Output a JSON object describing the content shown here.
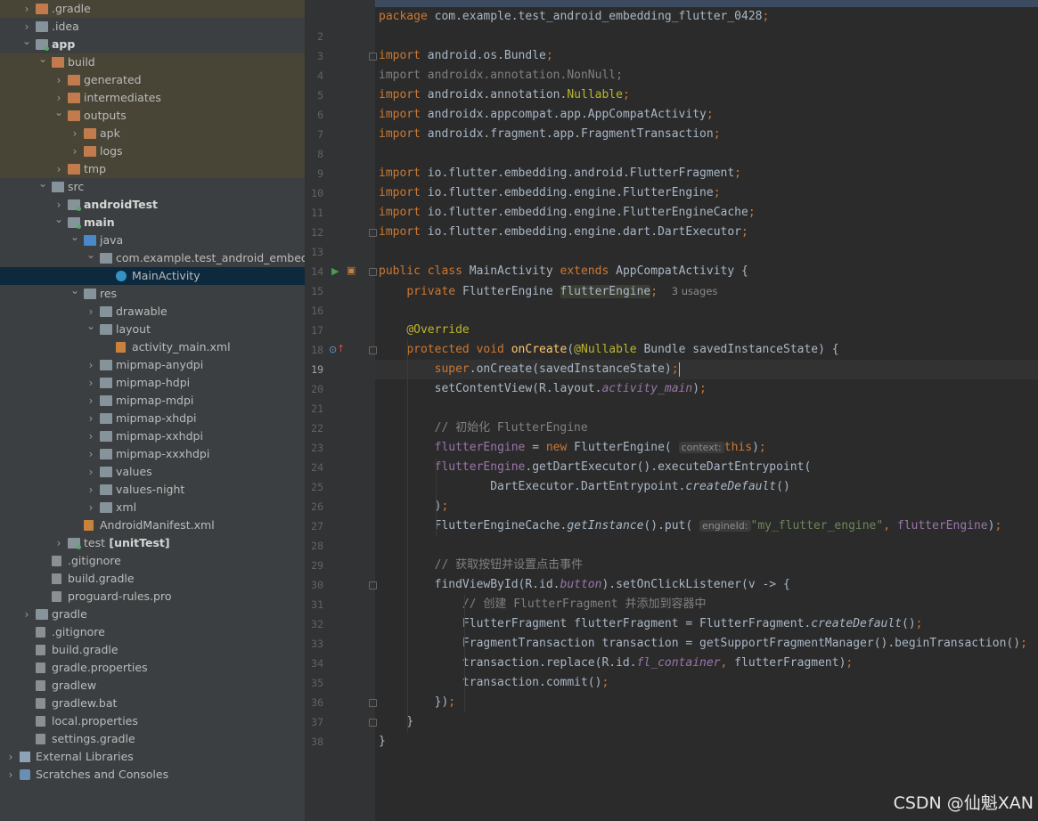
{
  "project_tree": [
    {
      "label": ".gradle",
      "depth": 2,
      "icon": "folder-orange",
      "arrow": "right",
      "hl": true
    },
    {
      "label": ".idea",
      "depth": 2,
      "icon": "folder-gray",
      "arrow": "right"
    },
    {
      "label": "app",
      "depth": 2,
      "icon": "module-folder",
      "arrow": "down",
      "bold": true
    },
    {
      "label": "build",
      "depth": 3,
      "icon": "folder-orange",
      "arrow": "down",
      "hl": true
    },
    {
      "label": "generated",
      "depth": 4,
      "icon": "folder-orange",
      "arrow": "right",
      "hl": true
    },
    {
      "label": "intermediates",
      "depth": 4,
      "icon": "folder-orange",
      "arrow": "right",
      "hl": true
    },
    {
      "label": "outputs",
      "depth": 4,
      "icon": "folder-orange",
      "arrow": "down",
      "hl": true
    },
    {
      "label": "apk",
      "depth": 5,
      "icon": "folder-orange",
      "arrow": "right",
      "hl": true
    },
    {
      "label": "logs",
      "depth": 5,
      "icon": "folder-orange",
      "arrow": "right",
      "hl": true
    },
    {
      "label": "tmp",
      "depth": 4,
      "icon": "folder-orange",
      "arrow": "right",
      "hl": true
    },
    {
      "label": "src",
      "depth": 3,
      "icon": "folder-gray",
      "arrow": "down"
    },
    {
      "label": "androidTest",
      "depth": 4,
      "icon": "module-folder",
      "arrow": "right",
      "bold": true
    },
    {
      "label": "main",
      "depth": 4,
      "icon": "module-folder",
      "arrow": "down",
      "bold": true
    },
    {
      "label": "java",
      "depth": 5,
      "icon": "folder-blue",
      "arrow": "down"
    },
    {
      "label": "com.example.test_android_embeddi",
      "depth": 6,
      "icon": "package-folder",
      "arrow": "down"
    },
    {
      "label": "MainActivity",
      "depth": 7,
      "icon": "class-icon",
      "arrow": "",
      "sel": true
    },
    {
      "label": "res",
      "depth": 5,
      "icon": "res-folder",
      "arrow": "down"
    },
    {
      "label": "drawable",
      "depth": 6,
      "icon": "folder-gray",
      "arrow": "right"
    },
    {
      "label": "layout",
      "depth": 6,
      "icon": "folder-gray",
      "arrow": "down"
    },
    {
      "label": "activity_main.xml",
      "depth": 7,
      "icon": "xml-file",
      "arrow": ""
    },
    {
      "label": "mipmap-anydpi",
      "depth": 6,
      "icon": "folder-gray",
      "arrow": "right"
    },
    {
      "label": "mipmap-hdpi",
      "depth": 6,
      "icon": "folder-gray",
      "arrow": "right"
    },
    {
      "label": "mipmap-mdpi",
      "depth": 6,
      "icon": "folder-gray",
      "arrow": "right"
    },
    {
      "label": "mipmap-xhdpi",
      "depth": 6,
      "icon": "folder-gray",
      "arrow": "right"
    },
    {
      "label": "mipmap-xxhdpi",
      "depth": 6,
      "icon": "folder-gray",
      "arrow": "right"
    },
    {
      "label": "mipmap-xxxhdpi",
      "depth": 6,
      "icon": "folder-gray",
      "arrow": "right"
    },
    {
      "label": "values",
      "depth": 6,
      "icon": "folder-gray",
      "arrow": "right"
    },
    {
      "label": "values-night",
      "depth": 6,
      "icon": "folder-gray",
      "arrow": "right"
    },
    {
      "label": "xml",
      "depth": 6,
      "icon": "folder-gray",
      "arrow": "right"
    },
    {
      "label": "AndroidManifest.xml",
      "depth": 5,
      "icon": "manifest-file",
      "arrow": ""
    },
    {
      "label": "test",
      "suffix": "[unitTest]",
      "depth": 4,
      "icon": "module-folder",
      "arrow": "right"
    },
    {
      "label": ".gitignore",
      "depth": 3,
      "icon": "gitignore-file",
      "arrow": ""
    },
    {
      "label": "build.gradle",
      "depth": 3,
      "icon": "gradle-file",
      "arrow": ""
    },
    {
      "label": "proguard-rules.pro",
      "depth": 3,
      "icon": "text-file",
      "arrow": ""
    },
    {
      "label": "gradle",
      "depth": 2,
      "icon": "folder-gray",
      "arrow": "right"
    },
    {
      "label": ".gitignore",
      "depth": 2,
      "icon": "gitignore-file",
      "arrow": ""
    },
    {
      "label": "build.gradle",
      "depth": 2,
      "icon": "gradle-file",
      "arrow": ""
    },
    {
      "label": "gradle.properties",
      "depth": 2,
      "icon": "properties-file",
      "arrow": ""
    },
    {
      "label": "gradlew",
      "depth": 2,
      "icon": "script-file",
      "arrow": ""
    },
    {
      "label": "gradlew.bat",
      "depth": 2,
      "icon": "text-file",
      "arrow": ""
    },
    {
      "label": "local.properties",
      "depth": 2,
      "icon": "properties-file",
      "arrow": ""
    },
    {
      "label": "settings.gradle",
      "depth": 2,
      "icon": "gradle-file",
      "arrow": ""
    },
    {
      "label": "External Libraries",
      "depth": 1,
      "icon": "library-icon",
      "arrow": "right"
    },
    {
      "label": "Scratches and Consoles",
      "depth": 1,
      "icon": "scratch-icon",
      "arrow": "right"
    }
  ],
  "editor": {
    "current_line": 19,
    "lines": [
      {
        "n": "",
        "segs": [
          [
            "kw",
            "package "
          ],
          [
            "",
            "com.example.test_android_embedding_flutter_0428"
          ],
          [
            "kw",
            ";"
          ]
        ]
      },
      {
        "n": "2",
        "segs": []
      },
      {
        "n": "3",
        "segs": [
          [
            "kw",
            "import "
          ],
          [
            "",
            "android.os.Bundle"
          ],
          [
            "kw",
            ";"
          ]
        ]
      },
      {
        "n": "4",
        "segs": [
          [
            "unused",
            "import androidx.annotation.NonNull;"
          ]
        ]
      },
      {
        "n": "5",
        "segs": [
          [
            "kw",
            "import "
          ],
          [
            "",
            "androidx.annotation."
          ],
          [
            "an",
            "Nullable"
          ],
          [
            "kw",
            ";"
          ]
        ]
      },
      {
        "n": "6",
        "segs": [
          [
            "kw",
            "import "
          ],
          [
            "",
            "androidx.appcompat.app.AppCompatActivity"
          ],
          [
            "kw",
            ";"
          ]
        ]
      },
      {
        "n": "7",
        "segs": [
          [
            "kw",
            "import "
          ],
          [
            "",
            "androidx.fragment.app.FragmentTransaction"
          ],
          [
            "kw",
            ";"
          ]
        ]
      },
      {
        "n": "8",
        "segs": []
      },
      {
        "n": "9",
        "segs": [
          [
            "kw",
            "import "
          ],
          [
            "",
            "io.flutter.embedding.android.FlutterFragment"
          ],
          [
            "kw",
            ";"
          ]
        ]
      },
      {
        "n": "10",
        "segs": [
          [
            "kw",
            "import "
          ],
          [
            "",
            "io.flutter.embedding.engine.FlutterEngine"
          ],
          [
            "kw",
            ";"
          ]
        ]
      },
      {
        "n": "11",
        "segs": [
          [
            "kw",
            "import "
          ],
          [
            "",
            "io.flutter.embedding.engine.FlutterEngineCache"
          ],
          [
            "kw",
            ";"
          ]
        ]
      },
      {
        "n": "12",
        "segs": [
          [
            "kw",
            "import "
          ],
          [
            "",
            "io.flutter.embedding.engine.dart.DartExecutor"
          ],
          [
            "kw",
            ";"
          ]
        ]
      },
      {
        "n": "13",
        "segs": []
      },
      {
        "n": "14",
        "segs": [
          [
            "kw",
            "public class "
          ],
          [
            "",
            "MainActivity "
          ],
          [
            "kw",
            "extends "
          ],
          [
            "",
            "AppCompatActivity {"
          ]
        ]
      },
      {
        "n": "15",
        "segs": [
          [
            "",
            "    "
          ],
          [
            "kw",
            "private "
          ],
          [
            "",
            "FlutterEngine "
          ],
          [
            "hlfld",
            "flutterEngine"
          ],
          [
            "kw",
            ";"
          ],
          [
            "",
            "  "
          ],
          [
            "usages",
            "3 usages"
          ]
        ]
      },
      {
        "n": "16",
        "segs": []
      },
      {
        "n": "17",
        "segs": [
          [
            "",
            "    "
          ],
          [
            "an",
            "@Override"
          ]
        ]
      },
      {
        "n": "18",
        "segs": [
          [
            "",
            "    "
          ],
          [
            "kw",
            "protected void "
          ],
          [
            "fn",
            "onCreate"
          ],
          [
            "",
            "("
          ],
          [
            "an",
            "@Nullable "
          ],
          [
            "",
            "Bundle savedInstanceState) {"
          ]
        ]
      },
      {
        "n": "19",
        "segs": [
          [
            "",
            "        "
          ],
          [
            "kw",
            "super"
          ],
          [
            "",
            ".onCreate(savedInstanceState)"
          ],
          [
            "kw",
            ";"
          ]
        ]
      },
      {
        "n": "20",
        "segs": [
          [
            "",
            "        setContentView(R.layout."
          ],
          [
            "itafld",
            "activity_main"
          ],
          [
            "",
            ")"
          ],
          [
            "kw",
            ";"
          ]
        ]
      },
      {
        "n": "21",
        "segs": []
      },
      {
        "n": "22",
        "segs": [
          [
            "",
            "        "
          ],
          [
            "cm",
            "// 初始化 FlutterEngine"
          ]
        ]
      },
      {
        "n": "23",
        "segs": [
          [
            "",
            "        "
          ],
          [
            "fld",
            "flutterEngine"
          ],
          [
            "",
            " = "
          ],
          [
            "kw",
            "new "
          ],
          [
            "",
            "FlutterEngine( "
          ],
          [
            "hint",
            "context:"
          ],
          [
            "",
            ""
          ],
          [
            "kw",
            "this"
          ],
          [
            "",
            ")"
          ],
          [
            "kw",
            ";"
          ]
        ]
      },
      {
        "n": "24",
        "segs": [
          [
            "",
            "        "
          ],
          [
            "fld",
            "flutterEngine"
          ],
          [
            "",
            ".getDartExecutor().executeDartEntrypoint("
          ]
        ]
      },
      {
        "n": "25",
        "segs": [
          [
            "",
            "                DartExecutor.DartEntrypoint."
          ],
          [
            "ita",
            "createDefault"
          ],
          [
            "",
            "()"
          ]
        ]
      },
      {
        "n": "26",
        "segs": [
          [
            "",
            "        )"
          ],
          [
            "kw",
            ";"
          ]
        ]
      },
      {
        "n": "27",
        "segs": [
          [
            "",
            "        FlutterEngineCache."
          ],
          [
            "ita",
            "getInstance"
          ],
          [
            "",
            "().put( "
          ],
          [
            "hint",
            "engineId:"
          ],
          [
            "st",
            "\"my_flutter_engine\""
          ],
          [
            "kw",
            ", "
          ],
          [
            "fld",
            "flutterEngine"
          ],
          [
            "",
            ")"
          ],
          [
            "kw",
            ";"
          ]
        ]
      },
      {
        "n": "28",
        "segs": []
      },
      {
        "n": "29",
        "segs": [
          [
            "",
            "        "
          ],
          [
            "cm",
            "// 获取按钮并设置点击事件"
          ]
        ]
      },
      {
        "n": "30",
        "segs": [
          [
            "",
            "        findViewById(R.id."
          ],
          [
            "itafld",
            "button"
          ],
          [
            "",
            ").setOnClickListener(v -> {"
          ]
        ]
      },
      {
        "n": "31",
        "segs": [
          [
            "",
            "            "
          ],
          [
            "cm",
            "// 创建 FlutterFragment 并添加到容器中"
          ]
        ]
      },
      {
        "n": "32",
        "segs": [
          [
            "",
            "            FlutterFragment flutterFragment = FlutterFragment."
          ],
          [
            "ita",
            "createDefault"
          ],
          [
            "",
            "()"
          ],
          [
            "kw",
            ";"
          ]
        ]
      },
      {
        "n": "33",
        "segs": [
          [
            "",
            "            FragmentTransaction transaction = getSupportFragmentManager().beginTransaction()"
          ],
          [
            "kw",
            ";"
          ]
        ]
      },
      {
        "n": "34",
        "segs": [
          [
            "",
            "            transaction.replace(R.id."
          ],
          [
            "itafld",
            "fl_container"
          ],
          [
            "kw",
            ", "
          ],
          [
            "",
            "flutterFragment)"
          ],
          [
            "kw",
            ";"
          ]
        ]
      },
      {
        "n": "35",
        "segs": [
          [
            "",
            "            transaction.commit()"
          ],
          [
            "kw",
            ";"
          ]
        ]
      },
      {
        "n": "36",
        "segs": [
          [
            "",
            "        })"
          ],
          [
            "kw",
            ";"
          ]
        ]
      },
      {
        "n": "37",
        "segs": [
          [
            "",
            "    }"
          ]
        ]
      },
      {
        "n": "38",
        "segs": [
          [
            "",
            "}"
          ]
        ]
      }
    ]
  },
  "watermark": "CSDN @仙魁XAN",
  "colors": {
    "sidebar_bg": "#3c3f41",
    "editor_bg": "#2b2b2b",
    "keyword": "#cc7832",
    "annotation": "#bbb529",
    "field": "#9876aa",
    "string": "#6a8759",
    "comment": "#808080"
  }
}
